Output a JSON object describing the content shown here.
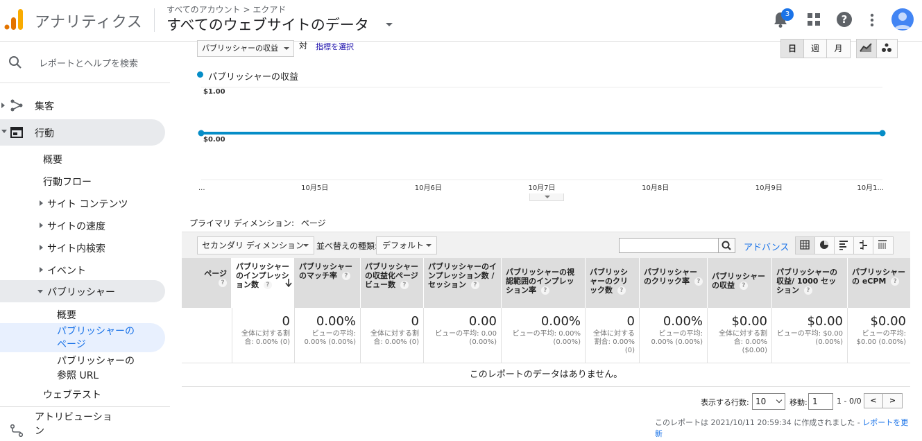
{
  "header": {
    "app_title": "アナリティクス",
    "breadcrumb": "すべてのアカウント > エクアド",
    "property_title": "すべてのウェブサイトのデータ",
    "notification_count": "3",
    "help_glyph": "?"
  },
  "sidebar": {
    "search_placeholder": "レポートとヘルプを検索",
    "acquisition": "集客",
    "behavior": "行動",
    "behavior_items": {
      "overview": "概要",
      "flow": "行動フロー",
      "site_content": "サイト コンテンツ",
      "site_speed": "サイトの速度",
      "site_search": "サイト内検索",
      "events": "イベント",
      "publisher": "パブリッシャー"
    },
    "publisher_items": {
      "overview": "概要",
      "pages_line1": "パブリッシャーの",
      "pages_line2": "ページ",
      "referrals_line1": "パブリッシャーの",
      "referrals_line2": "参照 URL"
    },
    "experiments": "ウェブテスト",
    "attribution_line1": "アトリビューショ",
    "attribution_line2": "ン"
  },
  "controls": {
    "metric_select": "パブリッシャーの収益",
    "vs": "対",
    "choose_metric": "指標を選択",
    "periods": [
      "日",
      "週",
      "月"
    ],
    "selected_period": "日"
  },
  "chart_data": {
    "type": "line",
    "title": "",
    "legend": "パブリッシャーの収益",
    "y_tick_labels": [
      "$1.00",
      "$0.00"
    ],
    "ylim": [
      0,
      1
    ],
    "x_tick_labels": [
      "...",
      "10月5日",
      "10月6日",
      "10月7日",
      "10月8日",
      "10月9日",
      "10月1..."
    ],
    "series": [
      {
        "name": "パブリッシャーの収益",
        "values": [
          0,
          0,
          0,
          0,
          0,
          0,
          0
        ]
      }
    ],
    "color": "#058dc7"
  },
  "table": {
    "primary_dimension_label": "プライマリ ディメンション:",
    "primary_dimension_value": "ページ",
    "secondary_dimension": "セカンダリ ディメンション",
    "sort_label": "並べ替えの種類:",
    "sort_value": "デフォルト",
    "advanced": "アドバンス",
    "headers": [
      "ページ",
      "パブリッシャーのインプレッション数",
      "パブリッシャーのマッチ率",
      "パブリッシャーの収益化ページビュー数",
      "パブリッシャーのインプレッション数 / セッション",
      "パブリッシャーの視認範囲のインプレッション率",
      "パブリッシャーのクリック数",
      "パブリッシャーのクリック率",
      "パブリッシャーの収益",
      "パブリッシャーの収益/ 1000 セッション",
      "パブリッシャーの eCPM"
    ],
    "totals": [
      {
        "value": "0",
        "sub": "全体に対する割合: 0.00% (0)"
      },
      {
        "value": "0.00%",
        "sub": "ビューの平均: 0.00% (0.00%)"
      },
      {
        "value": "0",
        "sub": "全体に対する割合: 0.00% (0)"
      },
      {
        "value": "0.00",
        "sub": "ビューの平均: 0.00 (0.00%)"
      },
      {
        "value": "0.00%",
        "sub": "ビューの平均: 0.00% (0.00%)"
      },
      {
        "value": "0",
        "sub": "全体に対する割合: 0.00% (0)"
      },
      {
        "value": "0.00%",
        "sub": "ビューの平均: 0.00% (0.00%)"
      },
      {
        "value": "$0.00",
        "sub": "全体に対する割合: 0.00% ($0.00)"
      },
      {
        "value": "$0.00",
        "sub": "ビューの平均: $0.00 (0.00%)"
      },
      {
        "value": "$0.00",
        "sub": "ビューの平均: $0.00 (0.00%)"
      }
    ],
    "no_data": "このレポートのデータはありません。"
  },
  "pager": {
    "rows_label": "表示する行数:",
    "rows_value": "10",
    "goto_label": "移動:",
    "goto_value": "1",
    "range": "1 - 0/0",
    "prev": "<",
    "next": ">"
  },
  "footer": {
    "created_text": "このレポートは 2021/10/11 20:59:34 に作成されました -",
    "refresh_link": "レポートを更新"
  }
}
